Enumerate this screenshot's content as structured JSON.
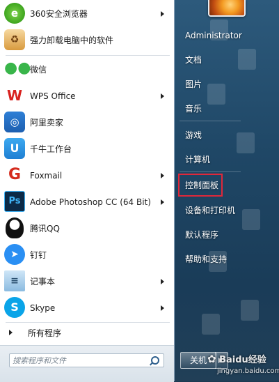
{
  "programs": [
    {
      "label": "360安全浏览器",
      "icon": "360-browser-icon",
      "has_submenu": true
    },
    {
      "label": "强力卸载电脑中的软件",
      "icon": "uninstall-box-icon",
      "has_submenu": false
    },
    {
      "label": "微信",
      "icon": "wechat-icon",
      "has_submenu": false
    },
    {
      "label": "WPS Office",
      "icon": "wps-office-icon",
      "has_submenu": true
    },
    {
      "label": "阿里卖家",
      "icon": "ali-seller-icon",
      "has_submenu": false
    },
    {
      "label": "千牛工作台",
      "icon": "qianniu-icon",
      "has_submenu": false
    },
    {
      "label": "Foxmail",
      "icon": "foxmail-icon",
      "has_submenu": true
    },
    {
      "label": "Adobe Photoshop CC (64 Bit)",
      "icon": "photoshop-icon",
      "has_submenu": true
    },
    {
      "label": "腾讯QQ",
      "icon": "qq-penguin-icon",
      "has_submenu": false
    },
    {
      "label": "钉钉",
      "icon": "dingtalk-icon",
      "has_submenu": false
    },
    {
      "label": "记事本",
      "icon": "notepad-icon",
      "has_submenu": true
    },
    {
      "label": "Skype",
      "icon": "skype-icon",
      "has_submenu": true
    }
  ],
  "all_programs_label": "所有程序",
  "search": {
    "placeholder": "搜索程序和文件"
  },
  "right_menu": {
    "user_name": "Administrator",
    "items": [
      "文档",
      "图片",
      "音乐",
      "游戏",
      "计算机",
      "控制面板",
      "设备和打印机",
      "默认程序",
      "帮助和支持"
    ],
    "highlighted_item": "控制面板"
  },
  "shutdown_label": "关机",
  "watermark": {
    "text": "Baidu经验",
    "url": "jingyan.baidu.com"
  },
  "colors": {
    "highlight_border": "#e0283a",
    "right_pane": "#1f4766"
  }
}
